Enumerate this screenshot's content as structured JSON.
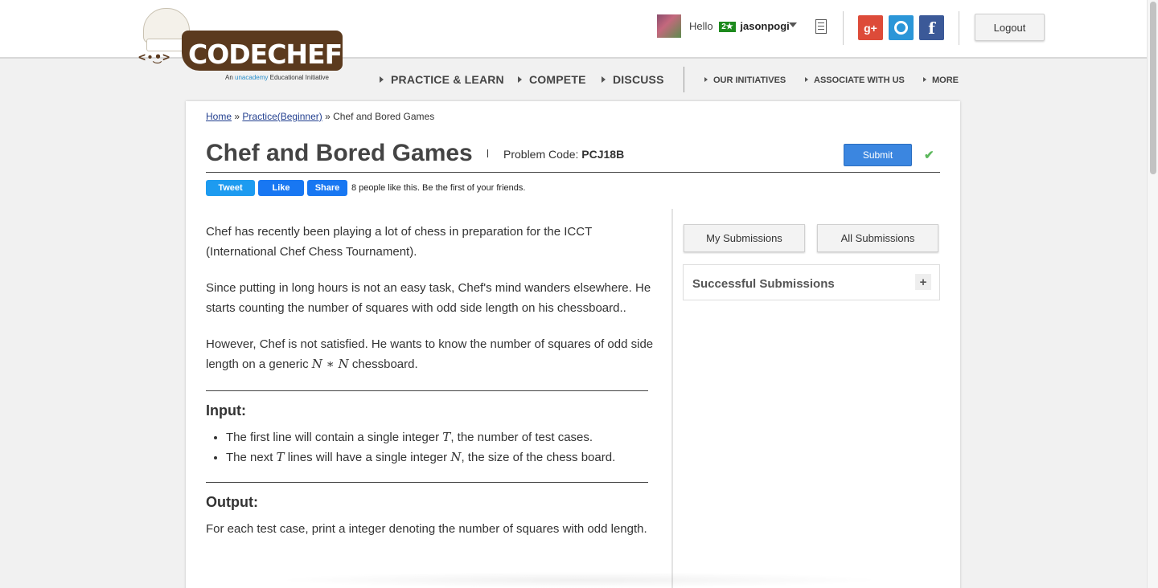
{
  "logo": {
    "face": "<•͜•>",
    "text": "CODECHEF",
    "tagline_prefix": "An",
    "tagline_brand": "unacademy",
    "tagline_suffix": "Educational Initiative"
  },
  "user": {
    "greeting": "Hello",
    "rating_badge": "2★",
    "username": "jasonpogi"
  },
  "header": {
    "logout_label": "Logout",
    "social": {
      "google": "g+",
      "facebook": "f"
    }
  },
  "nav": {
    "main": [
      "PRACTICE & LEARN",
      "COMPETE",
      "DISCUSS"
    ],
    "secondary": [
      "OUR INITIATIVES",
      "ASSOCIATE WITH US",
      "MORE"
    ]
  },
  "breadcrumb": {
    "home": "Home",
    "sep1": "»",
    "practice": "Practice(Beginner)",
    "sep2": "»",
    "current": "Chef and Bored Games"
  },
  "problem": {
    "title": "Chef and Bored Games",
    "code_label": "Problem Code:",
    "code": "PCJ18B",
    "submit_label": "Submit",
    "check": "✔"
  },
  "share": {
    "tweet": "Tweet",
    "like": "Like",
    "share": "Share",
    "like_text": "8 people like this. Be the first of your friends."
  },
  "statement": {
    "p1": "Chef has recently been playing a lot of chess in preparation for the ICCT (International Chef Chess Tournament).",
    "p2": "Since putting in long hours is not an easy task, Chef's mind wanders elsewhere. He starts counting the number of squares with odd side length on his chessboard..",
    "p3_pre": "However, Chef is not satisfied. He wants to know the number of squares of odd side length on a generic ",
    "p3_math": "N ∗ N",
    "p3_post": " chessboard.",
    "input_heading": "Input:",
    "input1_pre": "The first line will contain a single integer ",
    "input1_math": "T",
    "input1_post": ", the number of test cases.",
    "input2_pre": "The next ",
    "input2_math": "T",
    "input2_mid": " lines will have a single integer ",
    "input2_math2": "N",
    "input2_post": ", the size of the chess board.",
    "output_heading": "Output:",
    "output_text": "For each test case, print a integer denoting the number of squares with odd length."
  },
  "sidebar": {
    "my_submissions": "My Submissions",
    "all_submissions": "All Submissions",
    "successful_title": "Successful Submissions",
    "expand": "+"
  },
  "colors": {
    "submit": "#3b86e0",
    "brand_brown": "#5b3a1e",
    "rating_green": "#1d8a1d",
    "link": "#223f8f"
  }
}
